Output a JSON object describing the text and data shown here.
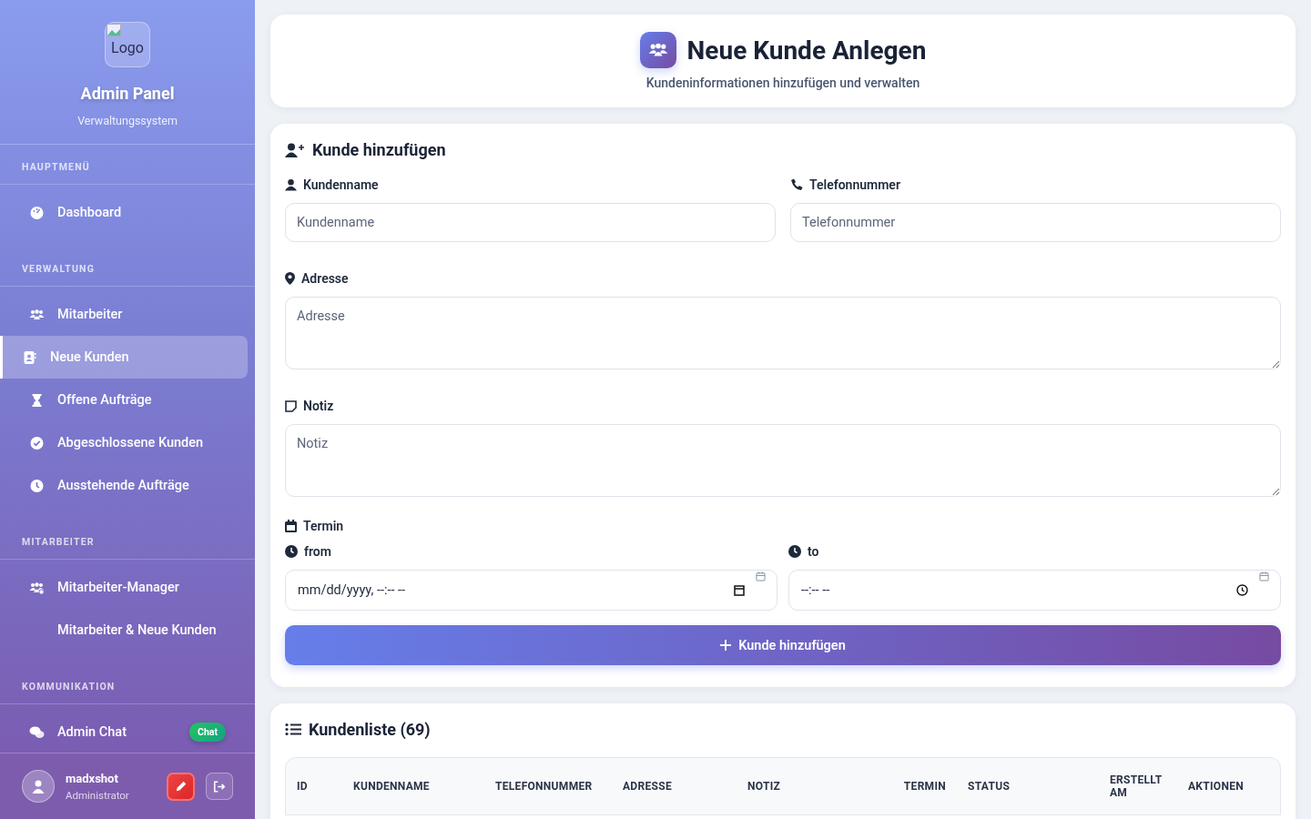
{
  "sidebar": {
    "logo_alt": "Logo",
    "title": "Admin Panel",
    "subtitle": "Verwaltungssystem",
    "sections": [
      {
        "heading": "HAUPTMENÜ",
        "items": [
          {
            "kind": "dashboard",
            "label": "Dashboard",
            "selected": false
          }
        ]
      },
      {
        "heading": "VERWALTUNG",
        "items": [
          {
            "kind": "users",
            "label": "Mitarbeiter",
            "selected": false
          },
          {
            "kind": "contact",
            "label": "Neue Kunden",
            "selected": true
          },
          {
            "kind": "hourglass",
            "label": "Offene Aufträge",
            "selected": false
          },
          {
            "kind": "check",
            "label": "Abgeschlossene Kunden",
            "selected": false
          },
          {
            "kind": "clock",
            "label": "Ausstehende Aufträge",
            "selected": false
          }
        ]
      },
      {
        "heading": "MITARBEITER",
        "items": [
          {
            "kind": "users-gear",
            "label": "Mitarbeiter-Manager",
            "selected": false
          },
          {
            "kind": "plain",
            "label": "Mitarbeiter & Neue Kunden",
            "selected": false
          }
        ]
      },
      {
        "heading": "KOMMUNIKATION",
        "items": [
          {
            "kind": "chat",
            "label": "Admin Chat",
            "selected": false,
            "badge": "Chat"
          }
        ]
      }
    ],
    "user": {
      "name": "madxshot",
      "role": "Administrator"
    }
  },
  "header": {
    "title": "Neue Kunde Anlegen",
    "subtitle": "Kundeninformationen hinzufügen und verwalten"
  },
  "form": {
    "title": "Kunde hinzufügen",
    "name_field": {
      "label": "Kundenname",
      "placeholder": "Kundenname"
    },
    "phone_field": {
      "label": "Telefonnummer",
      "placeholder": "Telefonnummer"
    },
    "address_field": {
      "label": "Adresse",
      "placeholder": "Adresse"
    },
    "note_field": {
      "label": "Notiz",
      "placeholder": "Notiz"
    },
    "appointment": {
      "label": "Termin",
      "from": {
        "label": "from",
        "placeholder": "mm/dd/yyyy, --:-- --"
      },
      "to": {
        "label": "to",
        "placeholder": "--:-- --"
      }
    },
    "submit": "Kunde hinzufügen"
  },
  "customer_list": {
    "title": "Kundenliste (69)",
    "columns": [
      "ID",
      "KUNDENNAME",
      "TELEFONNUMMER",
      "ADRESSE",
      "NOTIZ",
      "TERMIN",
      "STATUS",
      "ERSTELLT AM",
      "AKTIONEN"
    ]
  }
}
